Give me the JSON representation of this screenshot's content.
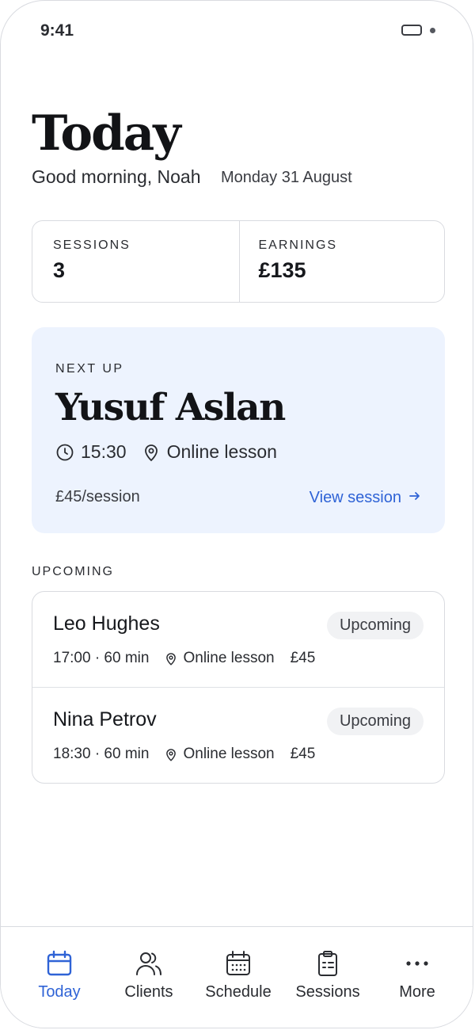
{
  "status_bar": {
    "time": "9:41"
  },
  "header": {
    "title": "Today",
    "greeting": "Good morning, Noah",
    "date": "Monday 31 August"
  },
  "stats": [
    {
      "label": "SESSIONS",
      "value": "3"
    },
    {
      "label": "EARNINGS",
      "value": "£135"
    }
  ],
  "next_up": {
    "eyebrow": "NEXT UP",
    "name": "Yusuf Aslan",
    "time": "15:30",
    "location": "Online lesson",
    "price": "£45/session",
    "link_label": "View session"
  },
  "upcoming": {
    "label": "UPCOMING",
    "items": [
      {
        "name": "Leo Hughes",
        "status": "Upcoming",
        "time": "17:00 · 60 min",
        "location": "Online lesson",
        "price": "£45"
      },
      {
        "name": "Nina Petrov",
        "status": "Upcoming",
        "time": "18:30 · 60 min",
        "location": "Online lesson",
        "price": "£45"
      }
    ]
  },
  "tabs": [
    {
      "label": "Today",
      "icon": "calendar-icon",
      "active": true
    },
    {
      "label": "Clients",
      "icon": "users-icon",
      "active": false
    },
    {
      "label": "Schedule",
      "icon": "calendar-grid-icon",
      "active": false
    },
    {
      "label": "Sessions",
      "icon": "clipboard-icon",
      "active": false
    },
    {
      "label": "More",
      "icon": "more-dots-icon",
      "active": false
    }
  ],
  "colors": {
    "accent": "#2f63d6",
    "next_card_bg": "#edf3fe",
    "badge_bg": "#f1f2f4",
    "border": "#d9dbe0",
    "text": "#16181c"
  }
}
